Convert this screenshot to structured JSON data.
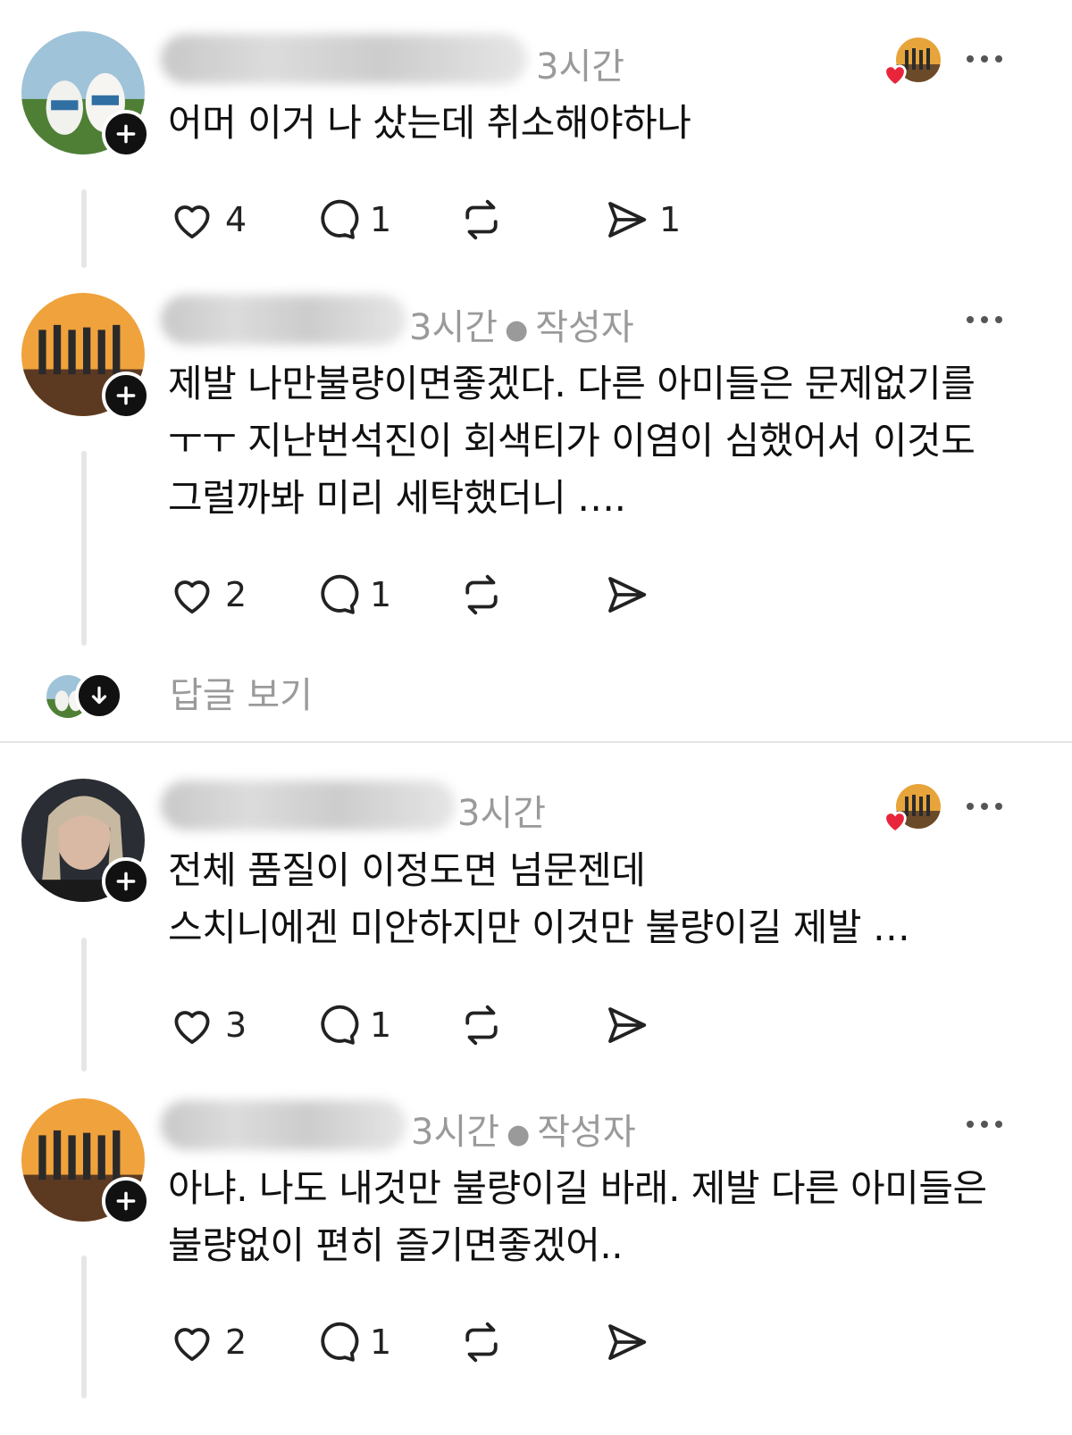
{
  "posts": [
    {
      "time": "3시간",
      "author_tag": "",
      "lines": [
        "어머 이거 나 샀는데 취소해야하나"
      ],
      "likes": "4",
      "replies": "1",
      "shares": "1"
    },
    {
      "time": "3시간",
      "author_tag": "작성자",
      "lines": [
        "제발 나만불량이면좋겠다. 다른 아미들은 문제없기를",
        "ㅜㅜ 지난번석진이 회색티가 이염이 심했어서 이것도",
        "그럴까봐 미리 세탁했더니 …."
      ],
      "likes": "2",
      "replies": "1",
      "shares": ""
    },
    {
      "time": "3시간",
      "author_tag": "",
      "lines": [
        "전체 품질이 이정도면 넘문젠데",
        "스치니에겐 미안하지만 이것만  불량이길 제발 …"
      ],
      "likes": "3",
      "replies": "1",
      "shares": ""
    },
    {
      "time": "3시간",
      "author_tag": "작성자",
      "lines": [
        "아냐. 나도 내것만  불량이길 바래. 제발 다른 아미들은",
        "불량없이 편히 즐기면좋겠어.."
      ],
      "likes": "2",
      "replies": "1",
      "shares": ""
    }
  ],
  "view_replies_label": "답글 보기",
  "icons": {
    "follow": "plus-icon",
    "like": "heart-outline-icon",
    "reply": "speech-bubble-icon",
    "repost": "repost-arrows-icon",
    "share": "paper-plane-icon",
    "more": "more-horizontal-icon",
    "liked_by_author": "red-heart-icon",
    "expand": "arrow-down-icon"
  },
  "colors": {
    "heart_red": "#e8253b",
    "meta_gray": "#9a9a9a",
    "thread_line": "#e6e6e6"
  }
}
